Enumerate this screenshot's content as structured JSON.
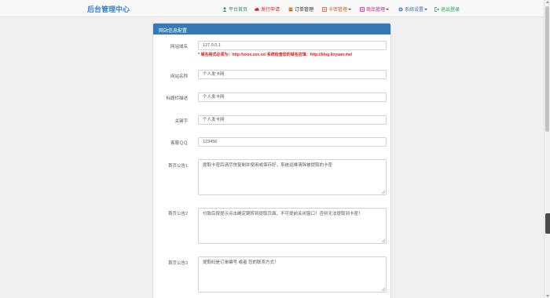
{
  "brand": "后台管理中心",
  "nav": {
    "items": [
      {
        "label": "平台首页",
        "color": "#2c8a5e"
      },
      {
        "label": "发行申请",
        "color": "#e02020"
      },
      {
        "label": "订单管理",
        "color": "#c0701c"
      },
      {
        "label": "卡密管理",
        "color": "#d0602a"
      },
      {
        "label": "商品管理",
        "color": "#c02b8a"
      },
      {
        "label": "系统设置",
        "color": "#3a6fb0"
      },
      {
        "label": "退出登录",
        "color": "#2aa05a"
      }
    ]
  },
  "panel": {
    "title": "网站信息配置"
  },
  "form": {
    "domain": {
      "label": "网站域名",
      "value": "127.0.0.1"
    },
    "domain_hint": "* 域名格式必须为：http://xxxx.xxx.xx/ 系统检查您的域名应填：http://blog.linyuan.me/",
    "site_name": {
      "label": "网站名称",
      "value": "个人发卡网"
    },
    "title_desc": {
      "label": "标题栏描述",
      "value": "个人发卡网"
    },
    "keywords": {
      "label": "关键字",
      "value": "个人发卡网"
    },
    "qq": {
      "label": "客服ＱＱ",
      "value": "123456"
    },
    "notice1": {
      "label": "首页公告1",
      "value": "提取卡密后请尽快复制并使用或保存好，系统运维清除被提取的卡密"
    },
    "notice2": {
      "label": "首页公告2",
      "value": "付款后按提示点击确定跳转到提取页面，不可提前关闭窗口！否则无法提取到卡密！"
    },
    "notice3": {
      "label": "首页公告3",
      "value": "提取码是订单编号 或者 您的联系方式！"
    }
  }
}
